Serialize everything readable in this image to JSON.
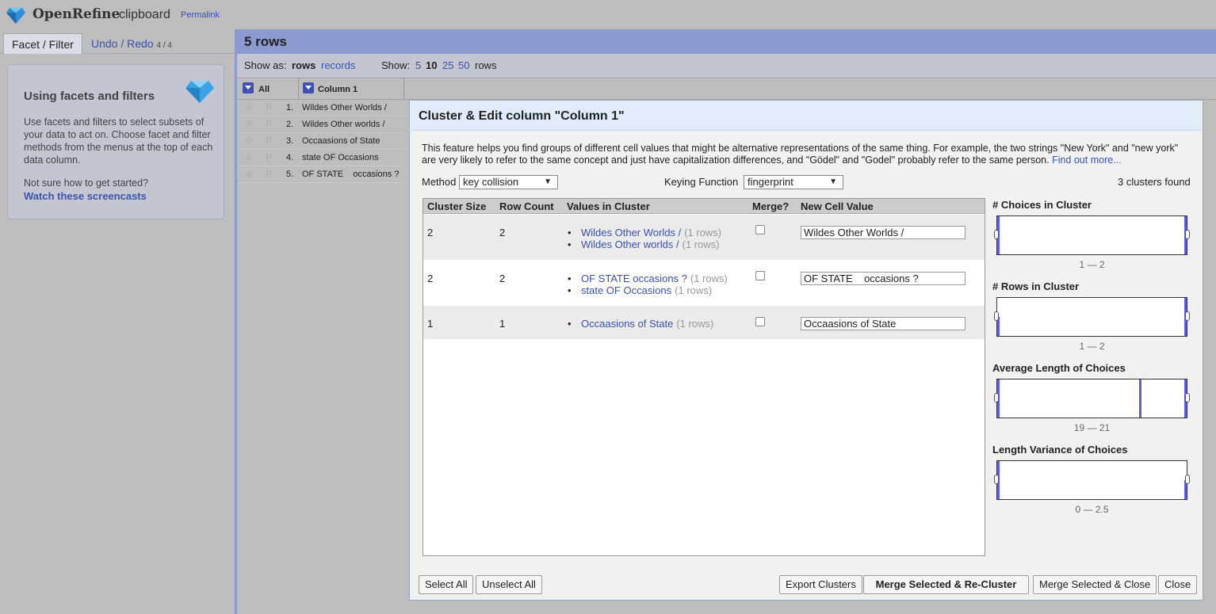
{
  "header": {
    "brand": "OpenRefine",
    "project_name": "clipboard",
    "permalink": "Permalink"
  },
  "left_panel": {
    "tabs": [
      {
        "label": "Facet / Filter"
      },
      {
        "label": "Undo / Redo",
        "count": "4 / 4"
      }
    ],
    "help": {
      "title": "Using facets and filters",
      "body": "Use facets and filters to select subsets of your data to act on. Choose facet and filter methods from the menus at the top of each data column.",
      "question": "Not sure how to get started?",
      "link": "Watch these screencasts"
    }
  },
  "grid": {
    "row_count": "5 rows",
    "show_as": {
      "label": "Show as:",
      "rows": "rows",
      "records": "records"
    },
    "show": {
      "label": "Show:",
      "options": [
        "5",
        "10",
        "25",
        "50"
      ],
      "selected": "10",
      "suffix": "rows"
    },
    "columns": {
      "all": "All",
      "col1": "Column 1"
    },
    "rows": [
      {
        "n": "1.",
        "v": "Wildes Other Worlds /"
      },
      {
        "n": "2.",
        "v": "Wildes Other worlds /"
      },
      {
        "n": "3.",
        "v": "Occaasions of State"
      },
      {
        "n": "4.",
        "v": "state OF Occasions"
      },
      {
        "n": "5.",
        "v": "OF STATE    occasions ?"
      }
    ]
  },
  "dialog": {
    "title": "Cluster & Edit column \"Column 1\"",
    "description": "This feature helps you find groups of different cell values that might be alternative representations of the same thing. For example, the two strings \"New York\" and \"new york\" are very likely to refer to the same concept and just have capitalization differences, and \"Gödel\" and \"Godel\" probably refer to the same person.",
    "find_out_more": "Find out more...",
    "method_label": "Method",
    "method_value": "key collision",
    "keying_label": "Keying Function",
    "keying_value": "fingerprint",
    "clusters_found": "3 clusters found",
    "table_headers": {
      "size": "Cluster Size",
      "rows": "Row Count",
      "values": "Values in Cluster",
      "merge": "Merge?",
      "new_value": "New Cell Value"
    },
    "clusters": [
      {
        "size": "2",
        "rows": "2",
        "values": [
          {
            "v": "Wildes Other Worlds /",
            "c": "(1 rows)"
          },
          {
            "v": "Wildes Other worlds /",
            "c": "(1 rows)"
          }
        ],
        "new_value": "Wildes Other Worlds /"
      },
      {
        "size": "2",
        "rows": "2",
        "values": [
          {
            "v": "OF STATE occasions ?",
            "c": "(1 rows)"
          },
          {
            "v": "state OF Occasions",
            "c": "(1 rows)"
          }
        ],
        "new_value": "OF STATE    occasions ?"
      },
      {
        "size": "1",
        "rows": "1",
        "values": [
          {
            "v": "Occaasions of State",
            "c": "(1 rows)"
          }
        ],
        "new_value": "Occaasions of State"
      }
    ],
    "facets": [
      {
        "title": "# Choices in Cluster",
        "range": "1 — 2"
      },
      {
        "title": "# Rows in Cluster",
        "range": "1 — 2"
      },
      {
        "title": "Average Length of Choices",
        "range": "19 — 21"
      },
      {
        "title": "Length Variance of Choices",
        "range": "0 — 2.5"
      }
    ],
    "buttons": {
      "select_all": "Select All",
      "unselect_all": "Unselect All",
      "export": "Export Clusters",
      "merge_recluster": "Merge Selected & Re-Cluster",
      "merge_close": "Merge Selected & Close",
      "close": "Close"
    }
  },
  "colors": {
    "accent": "#3a52b0",
    "bar": "#8b9bd1",
    "histogram": "#5b5ce0"
  }
}
